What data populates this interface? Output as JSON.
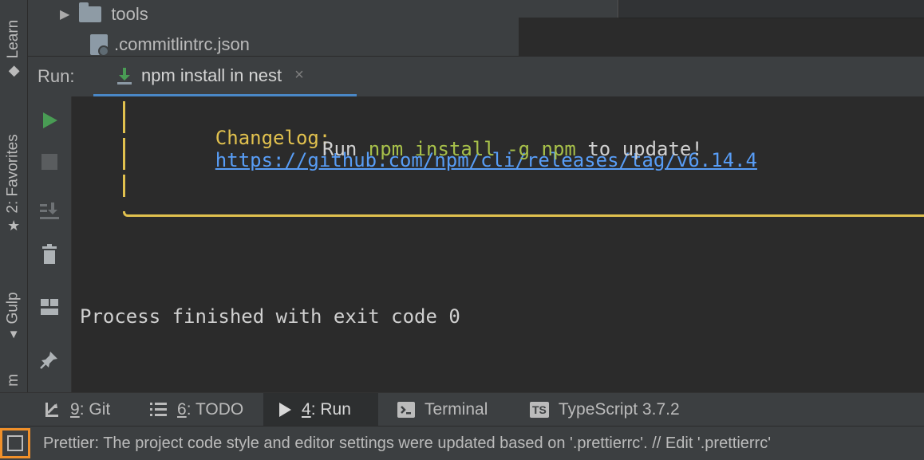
{
  "left_strip": {
    "learn_label": "Learn",
    "favorites_label": "2: Favorites",
    "gulp_label": "Gulp",
    "npm_label": "m"
  },
  "project_tree": {
    "items": [
      {
        "label": "tools",
        "type": "folder",
        "expanded": false
      },
      {
        "label": ".commitlintrc.json",
        "type": "file"
      }
    ]
  },
  "run_panel": {
    "label": "Run:",
    "tab_title": "npm install in nest",
    "close_glyph": "×"
  },
  "console": {
    "changelog_label": "Changelog:",
    "changelog_url": "https://github.com/npm/cli/releases/tag/v6.14.4",
    "update_prefix": "Run ",
    "update_cmd": "npm install -g npm",
    "update_suffix": " to update!",
    "process_line": "Process finished with exit code 0"
  },
  "bottom_tabs": [
    {
      "mnemonic": "9",
      "label": ": Git",
      "icon": "git-icon"
    },
    {
      "mnemonic": "6",
      "label": ": TODO",
      "icon": "todo-list-icon"
    },
    {
      "mnemonic": "4",
      "label": ": Run",
      "icon": "play-icon",
      "active": true
    },
    {
      "mnemonic": "",
      "label": "Terminal",
      "icon": "terminal-icon"
    },
    {
      "mnemonic": "",
      "label": "TypeScript 3.7.2",
      "icon": "typescript-icon",
      "badge": "TS"
    }
  ],
  "status_bar": {
    "message": "Prettier: The project code style and editor settings were updated based on '.prettierrc'. // Edit '.prettierrc'"
  },
  "colors": {
    "accent_orange": "#f0902a",
    "run_green": "#499c54",
    "console_yellow": "#e1c14e",
    "link_blue": "#589df6"
  }
}
